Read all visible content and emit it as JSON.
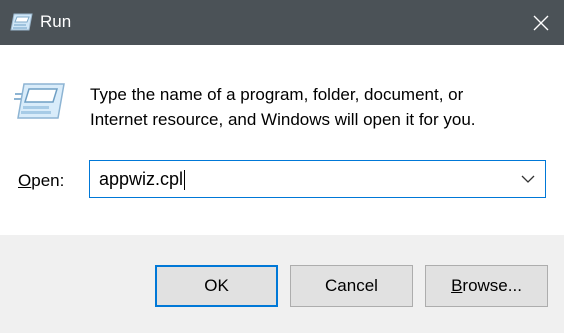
{
  "window": {
    "title": "Run",
    "title_bar_color": "#4b5257",
    "close_icon": "close-icon"
  },
  "message": {
    "line1": "Type the name of a program, folder, document, or",
    "line2": "Internet resource, and Windows will open it for you."
  },
  "open": {
    "label_accel": "O",
    "label_rest": "pen:",
    "value": "appwiz.cpl",
    "focus_color": "#0078d7"
  },
  "buttons": {
    "ok": "OK",
    "cancel": "Cancel",
    "browse_accel": "B",
    "browse_rest": "rowse..."
  }
}
